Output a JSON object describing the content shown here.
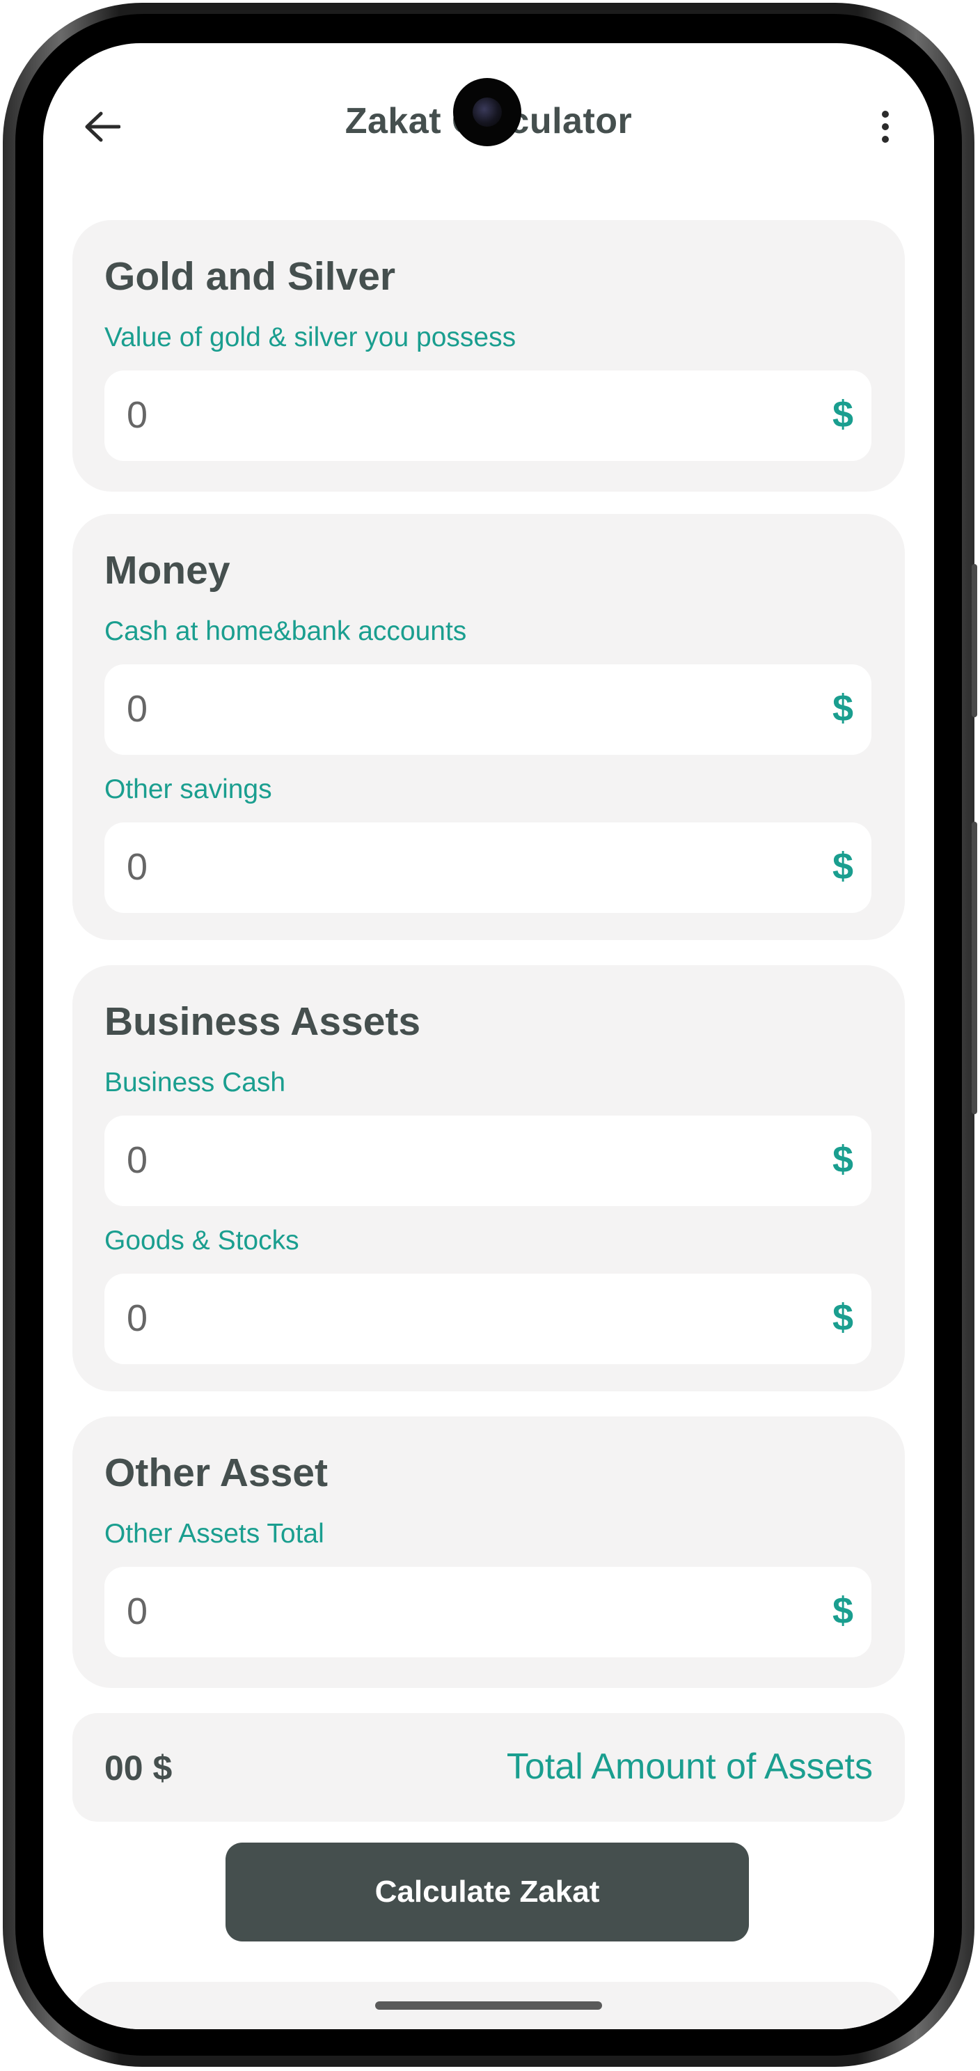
{
  "app_bar": {
    "title": "Zakat Calculator",
    "back_icon": "arrow-left-icon",
    "more_icon": "more-vertical-icon"
  },
  "sections": [
    {
      "title": "Gold and Silver",
      "fields": [
        {
          "label": "Value of gold & silver you possess",
          "value": "0",
          "currency": "$"
        }
      ]
    },
    {
      "title": "Money",
      "fields": [
        {
          "label": "Cash at home&bank accounts",
          "value": "0",
          "currency": "$"
        },
        {
          "label": "Other savings",
          "value": "0",
          "currency": "$"
        }
      ]
    },
    {
      "title": "Business Assets",
      "fields": [
        {
          "label": "Business Cash",
          "value": "0",
          "currency": "$"
        },
        {
          "label": "Goods & Stocks",
          "value": "0",
          "currency": "$"
        }
      ]
    },
    {
      "title": "Other Asset",
      "fields": [
        {
          "label": "Other Assets Total",
          "value": "0",
          "currency": "$"
        }
      ]
    }
  ],
  "total": {
    "value": "00 $",
    "label": "Total Amount of Assets"
  },
  "calculate_button": {
    "label": "Calculate Zakat"
  },
  "colors": {
    "accent": "#1a9e8f",
    "primary_dark": "#454f4e",
    "card_background": "#f4f3f3"
  }
}
